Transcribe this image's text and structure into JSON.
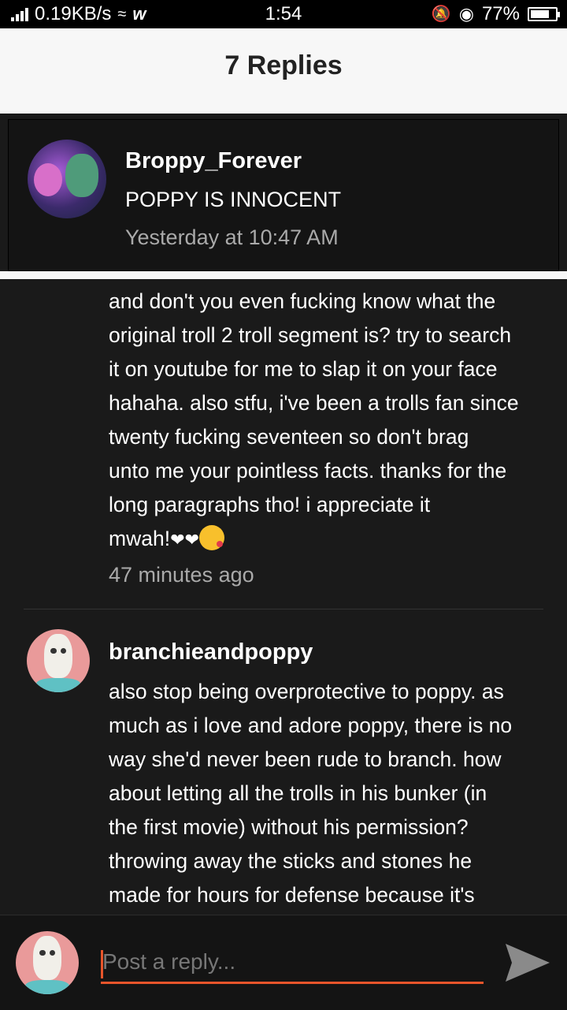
{
  "status_bar": {
    "speed": "0.19KB/s",
    "time": "1:54",
    "battery": "77%",
    "battery_level": 0.77
  },
  "header": {
    "title": "7 Replies"
  },
  "parent_comment": {
    "author": "Broppy_Forever",
    "text": "POPPY IS INNOCENT",
    "time": "Yesterday at 10:47 AM"
  },
  "replies": [
    {
      "lines": [
        "and don't you even fucking know what the",
        "original troll 2 troll segment is? try to search",
        "it on youtube for me to slap it on your face",
        "hahaha. also stfu, i've been a trolls fan since",
        "twenty fucking seventeen so don't brag",
        "unto me your pointless facts. thanks for the",
        "long paragraphs tho! i appreciate it",
        "mwah!"
      ],
      "time": "47 minutes ago"
    },
    {
      "author": "branchieandpoppy",
      "lines": [
        "also stop being overprotective to poppy. as",
        "much as i love and adore poppy, there is no",
        "way she'd never been rude to branch. how",
        "about letting all the trolls in his bunker (in",
        "the first movie) without his permission?",
        "throwing away the sticks and stones he",
        "made for hours for defense because it's"
      ]
    }
  ],
  "reply_box": {
    "placeholder": "Post a reply..."
  },
  "colors": {
    "accent": "#e8552b",
    "background": "#1a1a1a",
    "header_bg": "#f7f7f7"
  }
}
